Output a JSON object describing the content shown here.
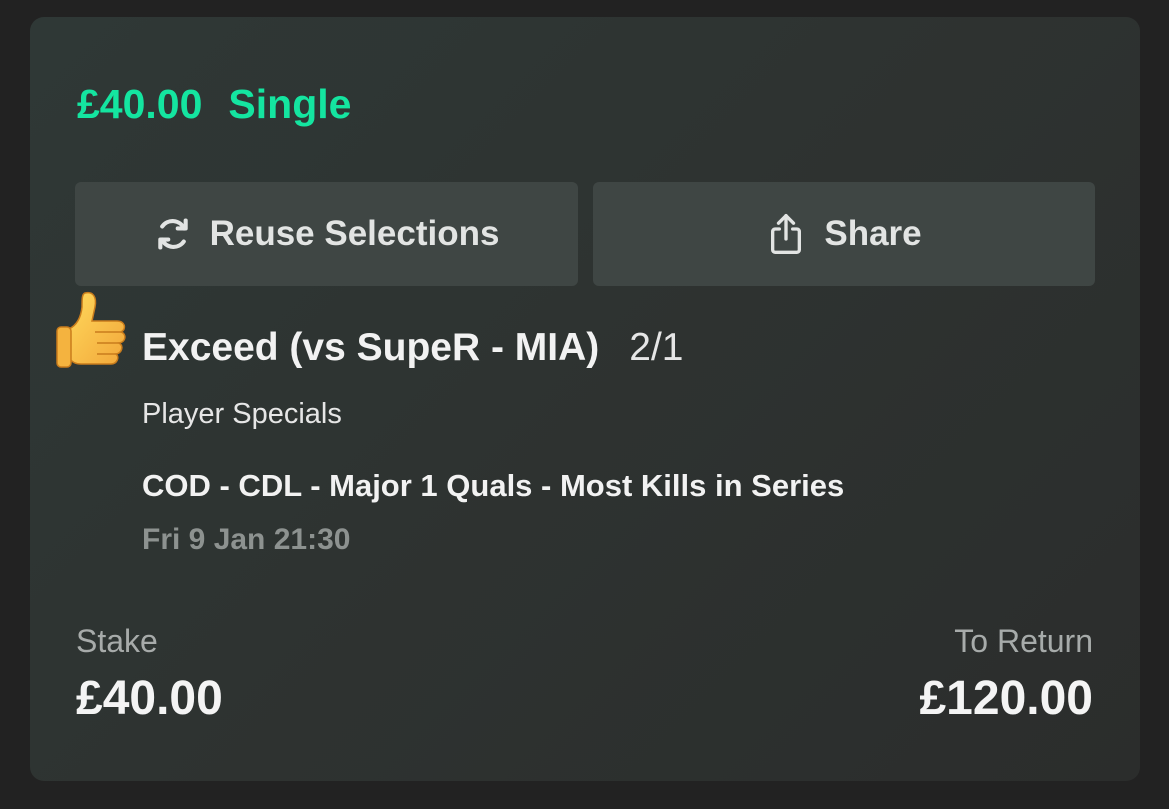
{
  "bet": {
    "stake_amount": "£40.00",
    "bet_type": "Single"
  },
  "actions": {
    "reuse_label": "Reuse Selections",
    "reuse_icon": "refresh-icon",
    "share_label": "Share",
    "share_icon": "share-icon"
  },
  "selection": {
    "status_icon": "thumbs-up-icon",
    "name": "Exceed (vs SupeR - MIA)",
    "odds": "2/1",
    "market": "Player Specials",
    "event": "COD - CDL - Major 1 Quals - Most Kills in Series",
    "datetime": "Fri 9 Jan 21:30"
  },
  "summary": {
    "stake_label": "Stake",
    "stake_value": "£40.00",
    "return_label": "To Return",
    "return_value": "£120.00"
  },
  "colors": {
    "accent": "#14e5a0",
    "background": "#222222",
    "card": "#2e3331",
    "button": "#3f4644"
  }
}
